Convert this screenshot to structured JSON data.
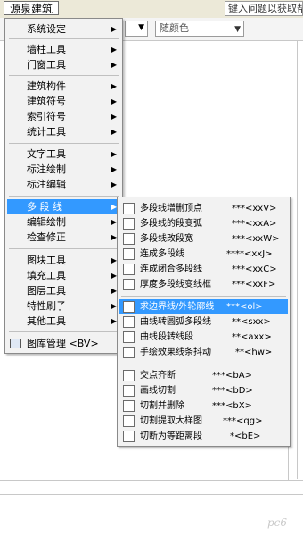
{
  "topbar": {
    "app_menu": "源泉建筑",
    "help_text": "键入问题以获取帮"
  },
  "toolbar": {
    "color_combo": "随颜色"
  },
  "main_menu": {
    "items": [
      {
        "label": "系统设定",
        "has_sub": true
      },
      {
        "label": "墙柱工具",
        "has_sub": true
      },
      {
        "label": "门窗工具",
        "has_sub": true
      },
      {
        "label": "建筑构件",
        "has_sub": true
      },
      {
        "label": "建筑符号",
        "has_sub": true
      },
      {
        "label": "索引符号",
        "has_sub": true
      },
      {
        "label": "统计工具",
        "has_sub": true
      },
      {
        "label": "文字工具",
        "has_sub": true
      },
      {
        "label": "标注绘制",
        "has_sub": true
      },
      {
        "label": "标注编辑",
        "has_sub": true
      },
      {
        "label": "多 段 线",
        "has_sub": true,
        "active": true
      },
      {
        "label": "编辑绘制",
        "has_sub": true
      },
      {
        "label": "检查修正",
        "has_sub": true
      },
      {
        "label": "图块工具",
        "has_sub": true
      },
      {
        "label": "填充工具",
        "has_sub": true
      },
      {
        "label": "图层工具",
        "has_sub": true
      },
      {
        "label": "特性刷子",
        "has_sub": true
      },
      {
        "label": "其他工具",
        "has_sub": true
      },
      {
        "label": "图库管理 <BV>",
        "has_sub": false
      }
    ]
  },
  "sub_menu": {
    "items": [
      {
        "label": "多段线增删顶点",
        "shortcut": "***<xxV>",
        "icon": "polyline-vertex-icon"
      },
      {
        "label": "多段线的段变弧",
        "shortcut": "***<xxA>",
        "icon": "segment-to-arc-icon"
      },
      {
        "label": "多段线改段宽",
        "shortcut": "***<xxW>",
        "icon": "segment-width-icon"
      },
      {
        "label": "连成多段线",
        "shortcut": "****<xxJ>",
        "icon": "join-polyline-icon"
      },
      {
        "label": "连成闭合多段线",
        "shortcut": "***<xxC>",
        "icon": "close-polyline-icon"
      },
      {
        "label": "厚度多段线变线框",
        "shortcut": "***<xxF>",
        "icon": "thickness-frame-icon"
      },
      {
        "label": "求边界线/外轮廓线",
        "shortcut": "***<ol>",
        "icon": "boundary-outline-icon",
        "active": true
      },
      {
        "label": "曲线转圆弧多段线",
        "shortcut": "**<sxx>",
        "icon": "curve-to-arc-icon"
      },
      {
        "label": "曲线段转线段",
        "shortcut": "**<axx>",
        "icon": "curve-to-line-icon"
      },
      {
        "label": "手绘效果线条抖动",
        "shortcut": "**<hw>",
        "icon": "hand-draw-icon"
      },
      {
        "label": "交点齐断",
        "shortcut": "***<bA>",
        "icon": "intersect-break-icon"
      },
      {
        "label": "画线切割",
        "shortcut": "***<bD>",
        "icon": "line-cut-icon"
      },
      {
        "label": "切割并删除",
        "shortcut": "***<bX>",
        "icon": "cut-delete-icon"
      },
      {
        "label": "切割提取大样图",
        "shortcut": "***<qg>",
        "icon": "extract-detail-icon"
      },
      {
        "label": "切断为等距离段",
        "shortcut": "*<bE>",
        "icon": "equal-segments-icon"
      }
    ]
  },
  "watermark": "pc6"
}
